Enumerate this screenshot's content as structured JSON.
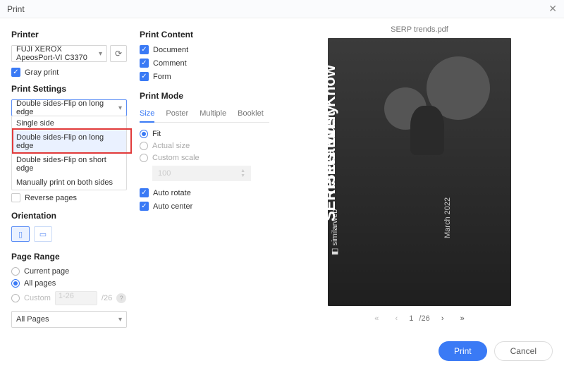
{
  "window": {
    "title": "Print"
  },
  "printer": {
    "label": "Printer",
    "selected": "FUJI XEROX ApeosPort-VI C3370",
    "grayPrint": "Gray print"
  },
  "printSettings": {
    "label": "Print Settings",
    "selected": "Double sides-Flip on long edge",
    "options": {
      "single": "Single side",
      "longEdge": "Double sides-Flip on long edge",
      "shortEdge": "Double sides-Flip on short edge",
      "manual": "Manually print on both sides"
    },
    "reversePages": "Reverse pages"
  },
  "orientation": {
    "label": "Orientation"
  },
  "pageRange": {
    "label": "Page Range",
    "current": "Current page",
    "all": "All pages",
    "custom": "Custom",
    "customPlaceholder": "1-26",
    "totalSuffix": "/26",
    "allPagesSelect": "All Pages"
  },
  "printContent": {
    "label": "Print Content",
    "document": "Document",
    "comment": "Comment",
    "form": "Form"
  },
  "printMode": {
    "label": "Print Mode",
    "tabs": {
      "size": "Size",
      "poster": "Poster",
      "multiple": "Multiple",
      "booklet": "Booklet"
    },
    "fit": "Fit",
    "actual": "Actual size",
    "customScale": "Custom scale",
    "scaleValue": "100",
    "autoRotate": "Auto rotate",
    "autoCenter": "Auto center"
  },
  "preview": {
    "filename": "SERP trends.pdf",
    "logo": "similarweb",
    "line1": "SERP Feature",
    "line2": "Trends Every",
    "line3": "SEO Must Know",
    "date": "March 2022",
    "pager": {
      "current": "1",
      "total": "/26"
    }
  },
  "footer": {
    "print": "Print",
    "cancel": "Cancel"
  }
}
